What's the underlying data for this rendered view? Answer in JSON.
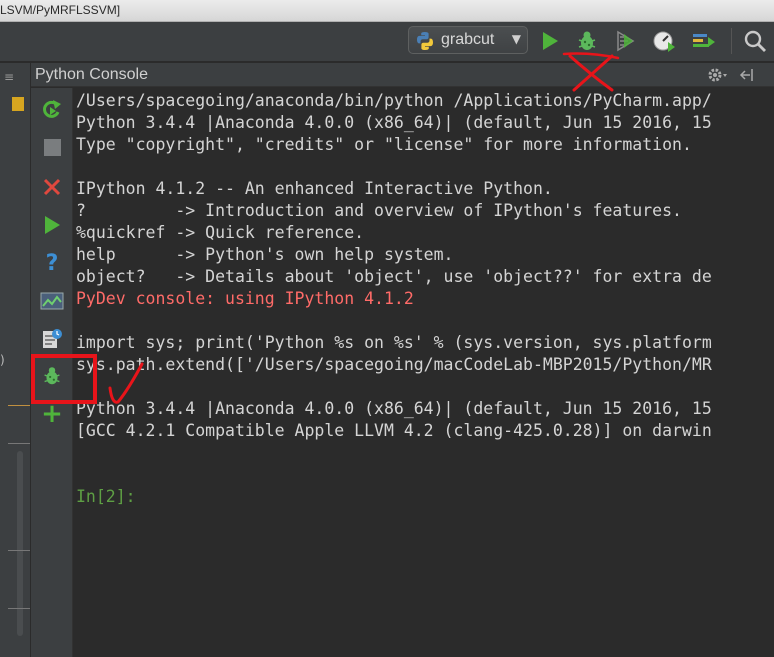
{
  "window": {
    "title_fragment": "LSVM/PyMRFLSSVM]"
  },
  "toolbar": {
    "run_config_label": "grabcut",
    "buttons": [
      {
        "name": "run-button",
        "icon": "play-icon"
      },
      {
        "name": "debug-button",
        "icon": "bug-icon"
      },
      {
        "name": "run-coverage-button",
        "icon": "coverage-icon"
      },
      {
        "name": "profile-button",
        "icon": "profiler-icon"
      },
      {
        "name": "concurrency-diagram-button",
        "icon": "concurrency-icon"
      },
      {
        "name": "search-everywhere-button",
        "icon": "search-icon"
      }
    ]
  },
  "console": {
    "title": "Python Console",
    "side_buttons": [
      {
        "name": "rerun-button",
        "icon": "rerun-icon"
      },
      {
        "name": "stop-button",
        "icon": "stop-icon"
      },
      {
        "name": "close-button",
        "icon": "close-icon"
      },
      {
        "name": "execute-button",
        "icon": "play-icon"
      },
      {
        "name": "help-button",
        "icon": "question-icon"
      },
      {
        "name": "show-variables-button",
        "icon": "variables-icon"
      },
      {
        "name": "history-button",
        "icon": "history-icon"
      },
      {
        "name": "attach-debugger-button",
        "icon": "bug-icon"
      },
      {
        "name": "new-console-button",
        "icon": "plus-icon"
      }
    ],
    "lines": [
      {
        "text": "/Users/spacegoing/anaconda/bin/python /Applications/PyCharm.app/",
        "style": "normal"
      },
      {
        "text": "Python 3.4.4 |Anaconda 4.0.0 (x86_64)| (default, Jun 15 2016, 15",
        "style": "normal"
      },
      {
        "text": "Type \"copyright\", \"credits\" or \"license\" for more information.",
        "style": "normal"
      },
      {
        "text": "",
        "style": "normal"
      },
      {
        "text": "IPython 4.1.2 -- An enhanced Interactive Python.",
        "style": "normal"
      },
      {
        "text": "?         -> Introduction and overview of IPython's features.",
        "style": "normal"
      },
      {
        "text": "%quickref -> Quick reference.",
        "style": "normal"
      },
      {
        "text": "help      -> Python's own help system.",
        "style": "normal"
      },
      {
        "text": "object?   -> Details about 'object', use 'object??' for extra de",
        "style": "normal"
      },
      {
        "text": "PyDev console: using IPython 4.1.2",
        "style": "err"
      },
      {
        "text": "",
        "style": "normal"
      },
      {
        "text": "import sys; print('Python %s on %s' % (sys.version, sys.platform",
        "style": "normal"
      },
      {
        "text": "sys.path.extend(['/Users/spacegoing/macCodeLab-MBP2015/Python/MR",
        "style": "normal"
      },
      {
        "text": "",
        "style": "normal"
      },
      {
        "text": "Python 3.4.4 |Anaconda 4.0.0 (x86_64)| (default, Jun 15 2016, 15",
        "style": "normal"
      },
      {
        "text": "[GCC 4.2.1 Compatible Apple LLVM 4.2 (clang-425.0.28)] on darwin",
        "style": "normal"
      },
      {
        "text": "",
        "style": "normal"
      },
      {
        "text": "",
        "style": "normal"
      },
      {
        "text": "In[2]:",
        "style": "prompt"
      }
    ]
  },
  "colors": {
    "annotation_red": "#e8141a",
    "run_green": "#4fb43b",
    "error_red": "#ff6b68",
    "prompt_green": "#5e9f44"
  }
}
